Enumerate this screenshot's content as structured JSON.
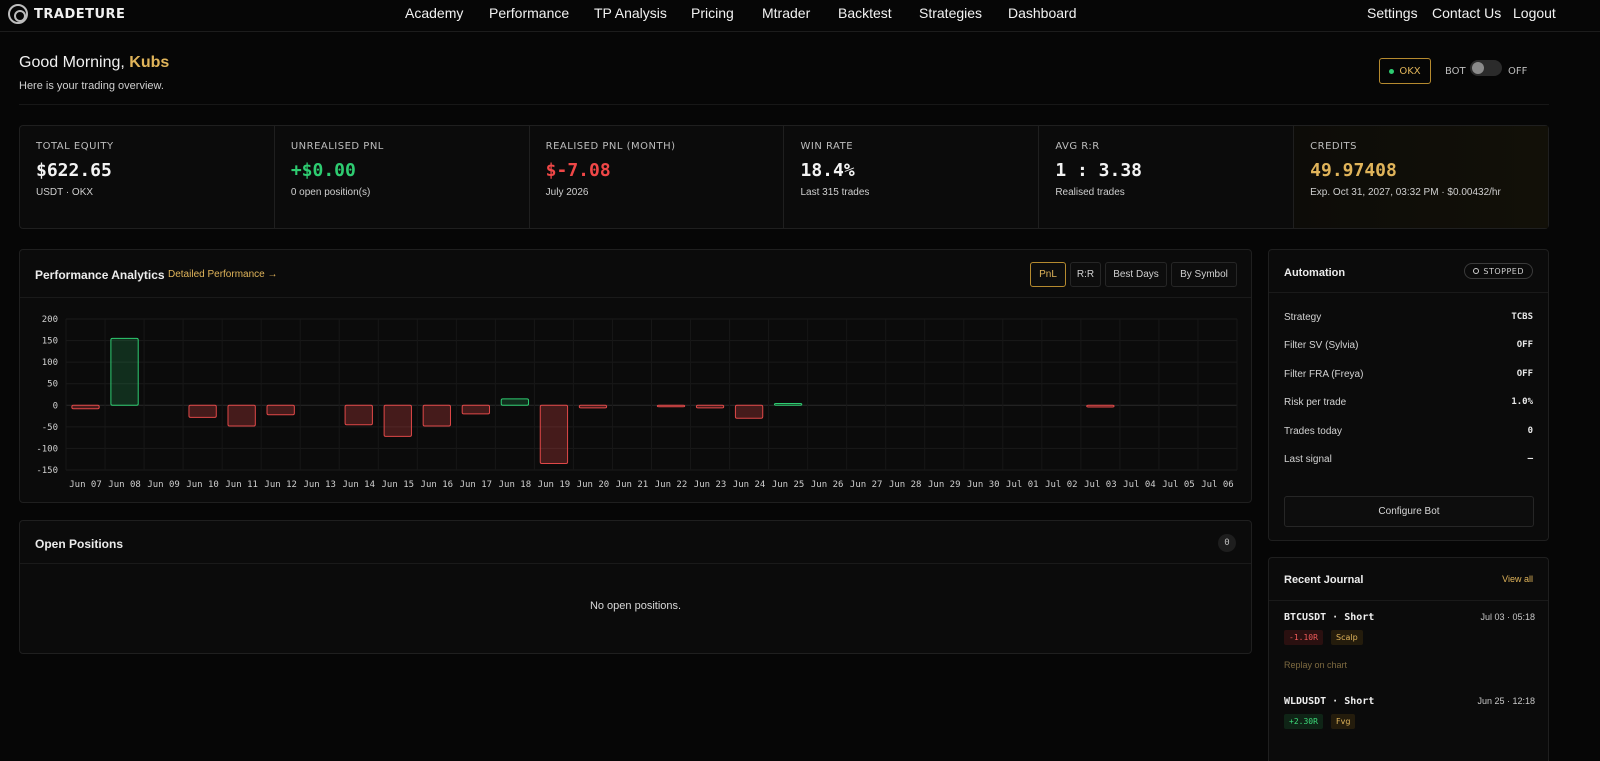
{
  "brand": {
    "name": "TRADETURE"
  },
  "nav": {
    "links": [
      "Academy",
      "Performance",
      "TP Analysis",
      "Pricing",
      "Mtrader",
      "Backtest",
      "Strategies",
      "Dashboard"
    ],
    "right": [
      "Settings",
      "Contact Us",
      "Logout"
    ]
  },
  "greeting": {
    "prefix": "Good Morning,",
    "name": "Kubs",
    "subtitle": "Here is your trading overview."
  },
  "header_controls": {
    "exchange": "OKX",
    "bot_label": "BOT",
    "bot_state": "OFF",
    "bot_on": false
  },
  "stats": [
    {
      "label": "TOTAL EQUITY",
      "value": "$622.65",
      "sub": "USDT · OKX",
      "tone": "neutral"
    },
    {
      "label": "UNREALISED PNL",
      "value": "+$0.00",
      "sub": "0 open position(s)",
      "tone": "green"
    },
    {
      "label": "REALISED PNL (MONTH)",
      "value": "$-7.08",
      "sub": "July 2026",
      "tone": "red"
    },
    {
      "label": "WIN RATE",
      "value": "18.4%",
      "sub": "Last 315 trades",
      "tone": "neutral"
    },
    {
      "label": "AVG R:R",
      "value": "1 : 3.38",
      "sub": "Realised trades",
      "tone": "neutral"
    },
    {
      "label": "CREDITS",
      "value": "49.97408",
      "sub": "Exp. Oct 31, 2027, 03:32 PM · $0.00432/hr",
      "tone": "gold"
    }
  ],
  "performance": {
    "title": "Performance Analytics",
    "link": "Detailed Performance →",
    "tabs": [
      "PnL",
      "R:R",
      "Best Days",
      "By Symbol"
    ],
    "active_tab": "PnL"
  },
  "chart_data": {
    "type": "bar",
    "categories": [
      "Jun 07",
      "Jun 08",
      "Jun 09",
      "Jun 10",
      "Jun 11",
      "Jun 12",
      "Jun 13",
      "Jun 14",
      "Jun 15",
      "Jun 16",
      "Jun 17",
      "Jun 18",
      "Jun 19",
      "Jun 20",
      "Jun 21",
      "Jun 22",
      "Jun 23",
      "Jun 24",
      "Jun 25",
      "Jun 26",
      "Jun 27",
      "Jun 28",
      "Jun 29",
      "Jun 30",
      "Jul 01",
      "Jul 02",
      "Jul 03",
      "Jul 04",
      "Jul 05",
      "Jul 06"
    ],
    "values": [
      -8,
      155,
      0,
      -28,
      -48,
      -22,
      0,
      -45,
      -72,
      -48,
      -20,
      15,
      -135,
      -6,
      0,
      -3,
      -6,
      -30,
      4,
      0,
      0,
      0,
      0,
      0,
      0,
      0,
      -4,
      0,
      0,
      0
    ],
    "yticks": [
      200,
      150,
      100,
      50,
      0,
      -50,
      -100,
      -150
    ],
    "ylim": [
      -160,
      200
    ],
    "grid": true,
    "colors": {
      "positive": "#2ecc71",
      "negative": "#e04848"
    }
  },
  "open_positions": {
    "title": "Open Positions",
    "count": "0",
    "empty": "No open positions."
  },
  "automation": {
    "title": "Automation",
    "status": "STOPPED",
    "rows": [
      {
        "k": "Strategy",
        "v": "TCBS"
      },
      {
        "k": "Filter SV (Sylvia)",
        "v": "OFF"
      },
      {
        "k": "Filter FRA (Freya)",
        "v": "OFF"
      },
      {
        "k": "Risk per trade",
        "v": "1.0%"
      },
      {
        "k": "Trades today",
        "v": "0"
      },
      {
        "k": "Last signal",
        "v": "—"
      }
    ],
    "button": "Configure Bot"
  },
  "journal": {
    "title": "Recent Journal",
    "view_all": "View all",
    "entries": [
      {
        "symbol": "BTCUSDT · Short",
        "time": "Jul 03 · 05:18",
        "r": "-1.10R",
        "r_tone": "red",
        "tag": "Scalp",
        "replay": "Replay on chart"
      },
      {
        "symbol": "WLDUSDT · Short",
        "time": "Jun 25 · 12:18",
        "r": "+2.30R",
        "r_tone": "green",
        "tag": "Fvg"
      }
    ]
  }
}
